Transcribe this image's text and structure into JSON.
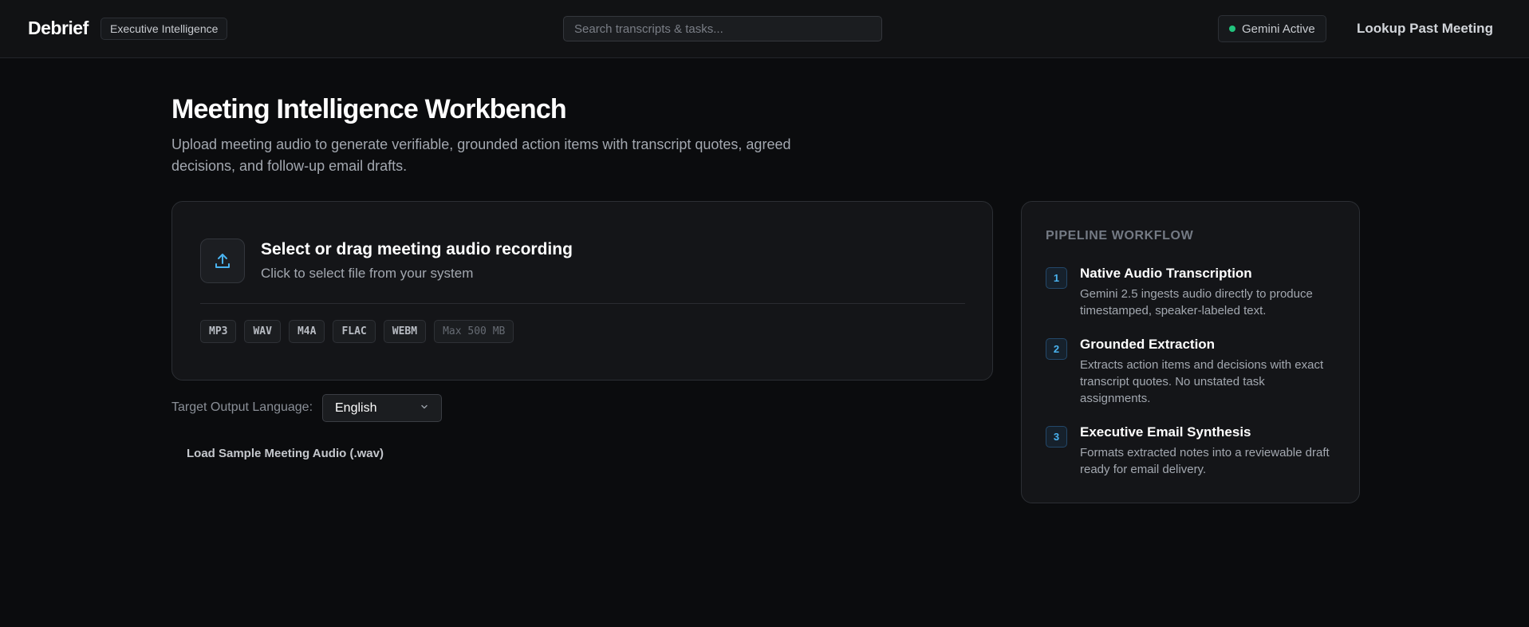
{
  "header": {
    "brand": "Debrief",
    "badge": "Executive Intelligence",
    "search_placeholder": "Search transcripts & tasks...",
    "status": "Gemini Active",
    "status_color": "#22c47e",
    "lookup_label": "Lookup Past Meeting"
  },
  "main": {
    "title": "Meeting Intelligence Workbench",
    "subtitle": "Upload meeting audio to generate verifiable, grounded action items with transcript quotes, agreed decisions, and follow-up email drafts."
  },
  "upload": {
    "icon": "upload-icon",
    "title": "Select or drag meeting audio recording",
    "subtitle": "Click to select file from your system",
    "formats": [
      "MP3",
      "WAV",
      "M4A",
      "FLAC",
      "WEBM"
    ],
    "max_size": "Max 500 MB"
  },
  "language": {
    "label": "Target Output Language:",
    "selected": "English",
    "icon": "chevron-down-icon"
  },
  "sample": {
    "label": "Load Sample Meeting Audio (.wav)"
  },
  "pipeline": {
    "heading": "PIPELINE WORKFLOW",
    "accent": "#4ab3f0",
    "steps": [
      {
        "num": "1",
        "title": "Native Audio Transcription",
        "desc": "Gemini 2.5 ingests audio directly to produce timestamped, speaker-labeled text."
      },
      {
        "num": "2",
        "title": "Grounded Extraction",
        "desc": "Extracts action items and decisions with exact transcript quotes. No unstated task assignments."
      },
      {
        "num": "3",
        "title": "Executive Email Synthesis",
        "desc": "Formats extracted notes into a reviewable draft ready for email delivery."
      }
    ]
  }
}
